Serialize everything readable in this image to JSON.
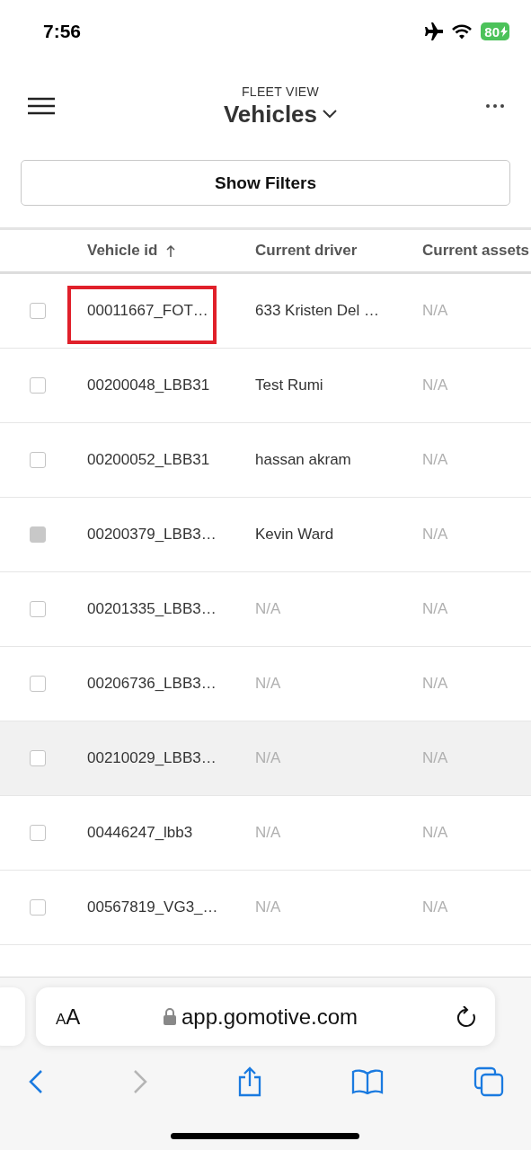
{
  "status_bar": {
    "time": "7:56",
    "battery": "80"
  },
  "header": {
    "eyebrow": "FLEET VIEW",
    "title": "Vehicles"
  },
  "filters_button": "Show Filters",
  "table": {
    "columns": [
      {
        "label": "Vehicle id",
        "sorted": true
      },
      {
        "label": "Current driver",
        "sorted": false
      },
      {
        "label": "Current assets",
        "sorted": false
      }
    ],
    "rows": [
      {
        "disabled": false,
        "highlighted": false,
        "annotated": true,
        "vehicle_id": "00011667_FOT…",
        "driver": "633 Kristen Del …",
        "driver_muted": false,
        "assets": "N/A"
      },
      {
        "disabled": false,
        "highlighted": false,
        "annotated": false,
        "vehicle_id": "00200048_LBB31",
        "driver": "Test Rumi",
        "driver_muted": false,
        "assets": "N/A"
      },
      {
        "disabled": false,
        "highlighted": false,
        "annotated": false,
        "vehicle_id": "00200052_LBB31",
        "driver": "hassan akram",
        "driver_muted": false,
        "assets": "N/A"
      },
      {
        "disabled": true,
        "highlighted": false,
        "annotated": false,
        "vehicle_id": "00200379_LBB3…",
        "driver": "Kevin Ward",
        "driver_muted": false,
        "assets": "N/A"
      },
      {
        "disabled": false,
        "highlighted": false,
        "annotated": false,
        "vehicle_id": "00201335_LBB3…",
        "driver": "N/A",
        "driver_muted": true,
        "assets": "N/A"
      },
      {
        "disabled": false,
        "highlighted": false,
        "annotated": false,
        "vehicle_id": "00206736_LBB3…",
        "driver": "N/A",
        "driver_muted": true,
        "assets": "N/A"
      },
      {
        "disabled": false,
        "highlighted": true,
        "annotated": false,
        "vehicle_id": "00210029_LBB3…",
        "driver": "N/A",
        "driver_muted": true,
        "assets": "N/A"
      },
      {
        "disabled": false,
        "highlighted": false,
        "annotated": false,
        "vehicle_id": "00446247_lbb3",
        "driver": "N/A",
        "driver_muted": true,
        "assets": "N/A"
      },
      {
        "disabled": false,
        "highlighted": false,
        "annotated": false,
        "vehicle_id": "00567819_VG3_…",
        "driver": "N/A",
        "driver_muted": true,
        "assets": "N/A"
      }
    ]
  },
  "browser": {
    "text_size_button": "AA",
    "url": "app.gomotive.com",
    "forward_disabled": true
  }
}
